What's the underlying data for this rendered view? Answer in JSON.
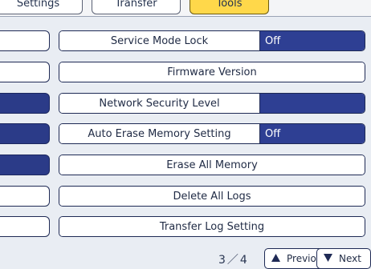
{
  "tabs": [
    "Settings",
    "Transfer",
    "Tools"
  ],
  "active_tab": "Tools",
  "rows": [
    {
      "label": "Service Mode Lock",
      "value": "Off"
    },
    {
      "label": "Firmware Version"
    },
    {
      "label": "Network Security Level",
      "value": ""
    },
    {
      "label": "Auto Erase Memory Setting",
      "value": "Off"
    },
    {
      "label": "Erase All Memory"
    },
    {
      "label": "Delete All Logs"
    },
    {
      "label": "Transfer Log Setting"
    }
  ],
  "pagination": {
    "page": "3／4",
    "previous_label": "Previous",
    "next_label": "Next"
  },
  "colors": {
    "active_tab": "#ffd84a",
    "value_bg": "#2e3f93",
    "selected_left": "#2b3b88"
  }
}
